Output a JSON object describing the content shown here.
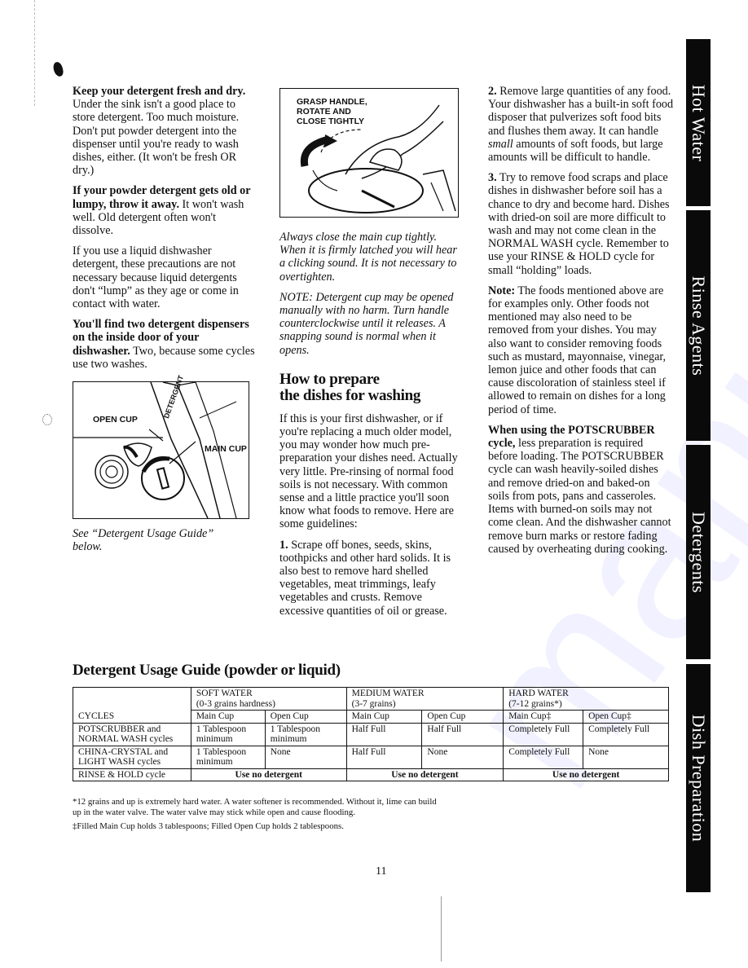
{
  "col1": {
    "p1_bold": "Keep your detergent fresh and dry.",
    "p1_text": " Under the sink isn't a good place to store detergent. Too much moisture. Don't put powder detergent into the dispenser until you're ready to wash dishes, either. (It won't be fresh OR dry.)",
    "p2_bold": "If your powder detergent gets old or lumpy, throw it away.",
    "p2_text": " It won't wash well. Old detergent often won't dissolve.",
    "p3_text": "If you use a liquid dishwasher detergent, these precautions are not necessary because liquid detergents don't “lump” as they age or come in contact with water.",
    "p4_bold": "You'll find two detergent dispensers on the inside door of your dishwasher.",
    "p4_text": " Two, because some cycles use two washes.",
    "figure": {
      "open_cup_label": "OPEN CUP",
      "main_cup_label": "MAIN CUP",
      "detergent_label": "DETERGENT"
    },
    "caption": "See “Detergent Usage Guide” below."
  },
  "col2": {
    "figure_label": "GRASP HANDLE, ROTATE AND CLOSE TIGHTLY",
    "caption1": "Always close the main cup tightly. When it is firmly latched you will hear a clicking sound. It is not necessary to overtighten.",
    "caption2": "NOTE: Detergent cup may be opened manually with no harm. Turn handle counterclockwise until it releases. A snapping sound is normal when it opens.",
    "heading_line1": "How to prepare",
    "heading_line2": "the dishes for washing",
    "intro": "If this is your first dishwasher, or if you're replacing a much older model, you may wonder how much pre-preparation your dishes need. Actually very little. Pre-rinsing of normal food soils is not necessary. With common sense and a little practice you'll soon know what foods to remove. Here are some guidelines:",
    "item1_num": "1.",
    "item1_text": " Scrape off bones, seeds, skins, toothpicks and other hard solids. It is also best to remove hard shelled vegetables, meat trimmings, leafy vegetables and crusts. Remove excessive quantities of oil or grease."
  },
  "col3": {
    "item2_num": "2.",
    "item2_text_a": " Remove large quantities of any food. Your dishwasher has a built-in soft food disposer that pulverizes soft food bits and flushes them away. It can handle ",
    "item2_italic": "small",
    "item2_text_b": " amounts of soft foods, but large amounts will be difficult to handle.",
    "item3_num": "3.",
    "item3_text": " Try to remove food scraps and place dishes in dishwasher before soil has a chance to dry and become hard. Dishes with dried-on soil are more difficult to wash and may not come clean in the NORMAL WASH cycle. Remember to use your RINSE & HOLD cycle for small “holding” loads.",
    "note_bold": "Note:",
    "note_text": " The foods mentioned above are for examples only. Other foods not mentioned may also need to be removed from your dishes. You may also want to consider removing foods such as mustard, mayonnaise, vinegar, lemon juice and other foods that can cause discoloration of stainless steel if allowed to remain on dishes for a long period of time.",
    "pots_bold": "When using the POTSCRUBBER cycle,",
    "pots_text": " less preparation is required before loading. The POTSCRUBBER cycle can wash heavily-soiled dishes and remove dried-on and baked-on soils from pots, pans and casseroles. Items with burned-on soils may not come clean. And the dishwasher cannot remove burn marks or restore fading caused by overheating during cooking."
  },
  "side_tabs": [
    "Hot Water",
    "Rinse Agents",
    "Detergents",
    "Dish Preparation"
  ],
  "guide": {
    "title": "Detergent Usage Guide (powder or liquid)",
    "cycles_header": "CYCLES",
    "groups": [
      {
        "name": "SOFT WATER",
        "range": "(0-3 grains hardness)",
        "main": "Main Cup",
        "open": "Open Cup"
      },
      {
        "name": "MEDIUM WATER",
        "range": "(3-7 grains)",
        "main": "Main Cup",
        "open": "Open Cup"
      },
      {
        "name": "HARD WATER",
        "range": "(7-12 grains*)",
        "main": "Main Cup‡",
        "open": "Open Cup‡"
      }
    ],
    "rows": [
      {
        "cycle_l1": "POTSCRUBBER and",
        "cycle_l2": "NORMAL WASH cycles",
        "cells": [
          "1 Tablespoon minimum",
          "1 Tablespoon minimum",
          "Half Full",
          "Half Full",
          "Completely Full",
          "Completely Full"
        ]
      },
      {
        "cycle_l1": "CHINA-CRYSTAL and",
        "cycle_l2": "LIGHT WASH cycles",
        "cells": [
          "1 Tablespoon minimum",
          "None",
          "Half Full",
          "None",
          "Completely Full",
          "None"
        ]
      }
    ],
    "rinse_row": {
      "cycle": "RINSE & HOLD cycle",
      "value": "Use no detergent"
    },
    "footnote1": "*12 grains and up is extremely hard water. A water softener is recommended. Without it, lime can build up in the water valve. The water valve may stick while open and cause flooding.",
    "footnote2": "‡Filled Main Cup holds 3 tablespoons; Filled Open Cup holds 2 tablespoons."
  },
  "page_number": "11"
}
